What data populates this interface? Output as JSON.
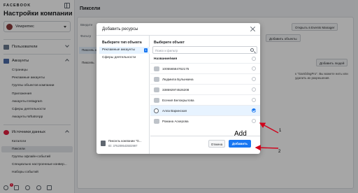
{
  "sidebar": {
    "brand": "FACEBOOK",
    "title": "Настройки компании",
    "account_name": "Vewpemec",
    "sections": [
      {
        "label": "Пользователи"
      },
      {
        "label": "Аккаунты"
      },
      {
        "label": "Источники данных"
      }
    ],
    "account_items": [
      "Страницы",
      "Рекламные аккаунты",
      "Группы объектов компании",
      "Приложения",
      "Аккаунты Instagram",
      "Сферы деятельности",
      "Аккаунты WhatsApp"
    ],
    "data_items": [
      "Каталоги",
      "Пиксели",
      "Группы офлайн-событий",
      "Специально настроенные конвер...",
      "Наборы событий"
    ],
    "notification_count": "1",
    "colors": {
      "users": "#6b7a8f",
      "accounts": "#4a6aa8",
      "data": "#e41e3f"
    }
  },
  "main": {
    "title": "Пиксели",
    "tab_fragment": "Введите",
    "filter_fragment": "Фильтр",
    "selected_item": "Пиксель к",
    "second_item": "Пиксель",
    "open_events_button": "Открыть в Events Manager",
    "add_objects_button": "Добавить объекты",
    "add_people_button": "Добавить людей",
    "info_text": "к \"GamblingPro\". Вы можете нить или удалить их разрешения."
  },
  "modal": {
    "title": "Добавить ресурсы",
    "left_header": "Выберите тип объекта",
    "types": [
      {
        "label": "Рекламные аккаунты",
        "selected": true,
        "badge": "1"
      },
      {
        "label": "Сферы деятельности",
        "selected": false
      }
    ],
    "pixel_name": "Пиксель компании \"G...",
    "pixel_id": "ID: 375209543502997",
    "right_header": "Выберите объект",
    "search_placeholder": "Поиск и фильтр",
    "column_header": "Название/имя",
    "rows": [
      {
        "name": "100556584762175",
        "icon": "folder",
        "selected": false
      },
      {
        "name": "Людмила Булынкина",
        "icon": "folder",
        "selected": false
      },
      {
        "name": "338592974526208",
        "icon": "folder",
        "selected": false
      },
      {
        "name": "Есения Белокрылова",
        "icon": "folder",
        "selected": false
      },
      {
        "name": "Алла Варинская",
        "icon": "user",
        "selected": true
      },
      {
        "name": "Романа Аскерова",
        "icon": "folder",
        "selected": false
      }
    ],
    "cancel_label": "Отмена",
    "add_label": "Добавить"
  },
  "annotations": {
    "add_text": "Add",
    "step1": "1",
    "step2": "2"
  }
}
